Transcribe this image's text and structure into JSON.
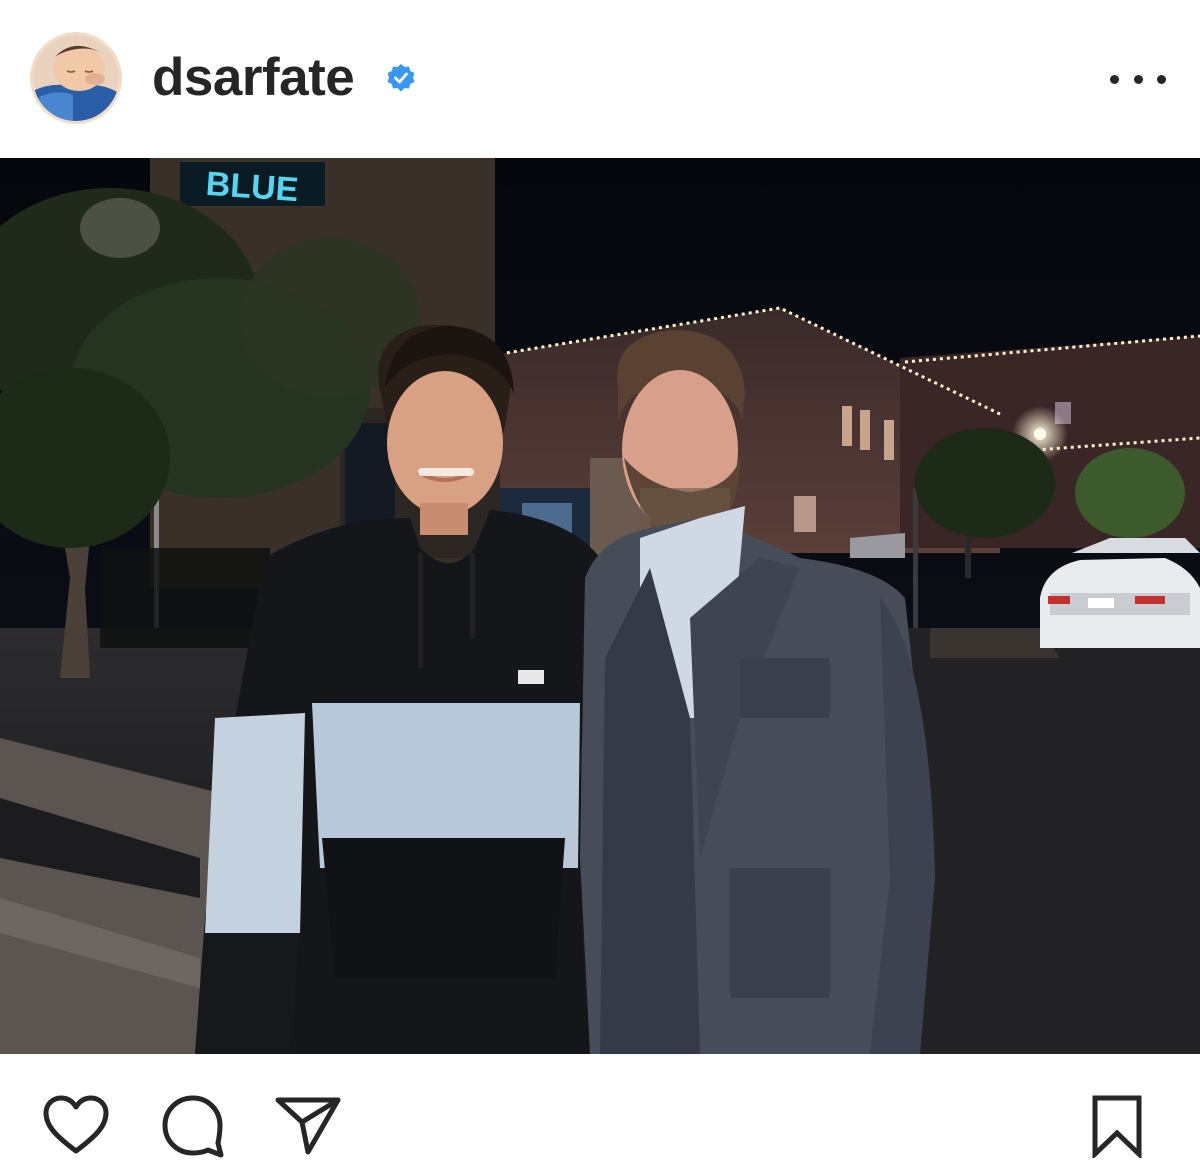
{
  "header": {
    "username": "dsarfate",
    "avatar_icon": "profile-avatar",
    "verified_icon": "verified-badge-icon",
    "verified_color": "#3897f0",
    "more_icon": "more-options-icon"
  },
  "photo": {
    "description_icon": "post-photo",
    "sign_text": "BLUE"
  },
  "actions": {
    "like_icon": "heart-icon",
    "comment_icon": "comment-icon",
    "share_icon": "send-icon",
    "save_icon": "bookmark-icon"
  }
}
